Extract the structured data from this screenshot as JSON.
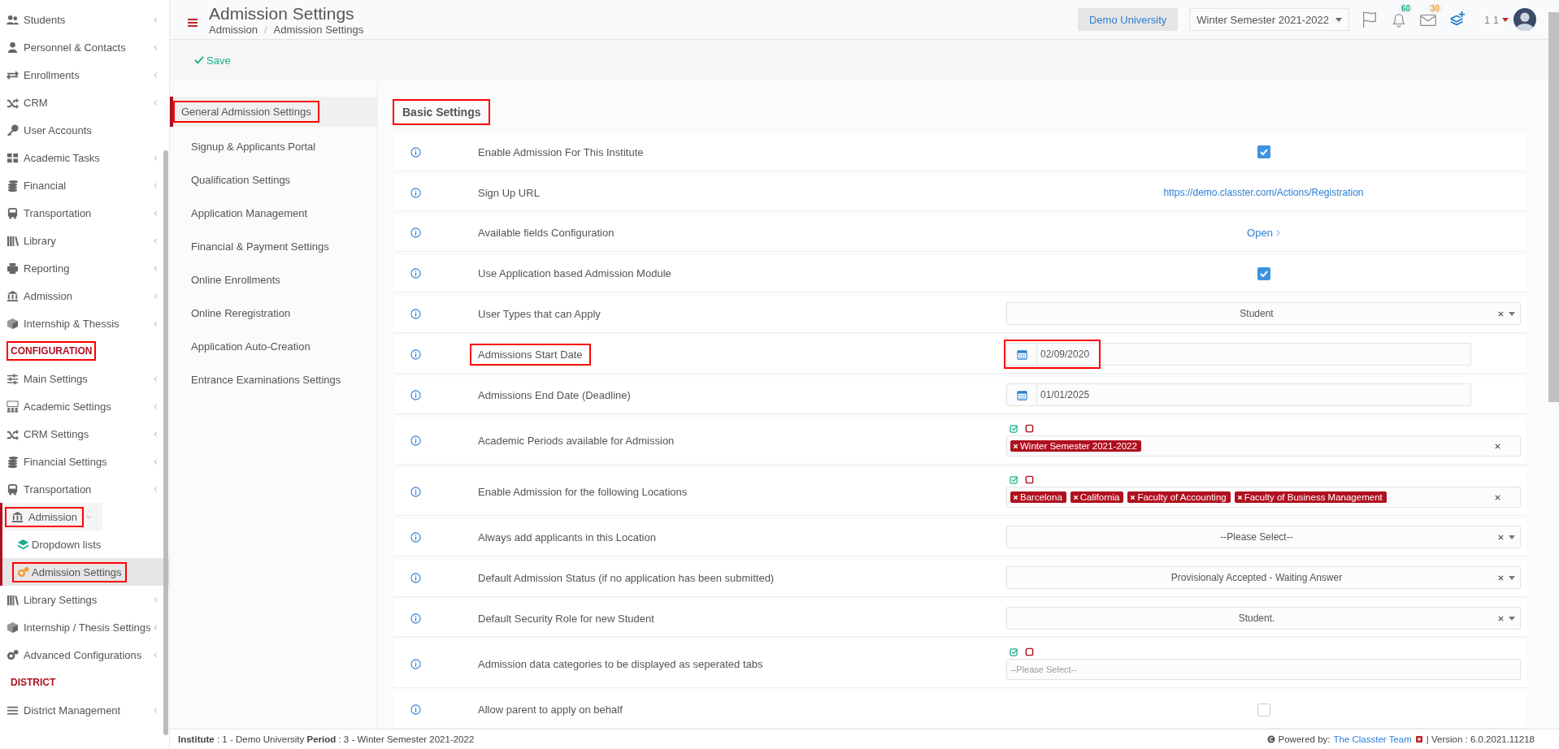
{
  "sidebar": {
    "items": [
      {
        "kind": "item",
        "label": "Students",
        "submenu": true,
        "expanded": false,
        "highlighted": false
      },
      {
        "kind": "item",
        "label": "Personnel & Contacts",
        "submenu": true,
        "expanded": false,
        "highlighted": false
      },
      {
        "kind": "item",
        "label": "Enrollments",
        "submenu": true,
        "expanded": false,
        "highlighted": false
      },
      {
        "kind": "item",
        "label": "CRM",
        "submenu": true,
        "expanded": false,
        "highlighted": false
      },
      {
        "kind": "item",
        "label": "User Accounts",
        "submenu": false,
        "expanded": false,
        "highlighted": false
      },
      {
        "kind": "item",
        "label": "Academic Tasks",
        "submenu": true,
        "expanded": false,
        "highlighted": false
      },
      {
        "kind": "item",
        "label": "Financial",
        "submenu": true,
        "expanded": false,
        "highlighted": false
      },
      {
        "kind": "item",
        "label": "Transportation",
        "submenu": true,
        "expanded": false,
        "highlighted": false
      },
      {
        "kind": "item",
        "label": "Library",
        "submenu": true,
        "expanded": false,
        "highlighted": false
      },
      {
        "kind": "item",
        "label": "Reporting",
        "submenu": true,
        "expanded": false,
        "highlighted": false
      },
      {
        "kind": "item",
        "label": "Admission",
        "submenu": true,
        "expanded": false,
        "highlighted": false
      },
      {
        "kind": "item",
        "label": "Internship & Thessis",
        "submenu": true,
        "expanded": false,
        "highlighted": false
      },
      {
        "kind": "heading",
        "label": "CONFIGURATION",
        "highlighted": true
      },
      {
        "kind": "item",
        "label": "Main Settings",
        "submenu": true,
        "expanded": false,
        "highlighted": false
      },
      {
        "kind": "item",
        "label": "Academic Settings",
        "submenu": true,
        "expanded": false,
        "highlighted": false
      },
      {
        "kind": "item",
        "label": "CRM Settings",
        "submenu": true,
        "expanded": false,
        "highlighted": false
      },
      {
        "kind": "item",
        "label": "Financial Settings",
        "submenu": true,
        "expanded": false,
        "highlighted": false
      },
      {
        "kind": "item",
        "label": "Transportation",
        "submenu": true,
        "expanded": false,
        "highlighted": false
      },
      {
        "kind": "item",
        "label": "Admission",
        "submenu": true,
        "expanded": true,
        "highlighted": true,
        "children": [
          {
            "label": "Dropdown lists",
            "selected": false,
            "highlighted": false
          },
          {
            "label": "Admission Settings",
            "selected": true,
            "highlighted": true
          }
        ]
      },
      {
        "kind": "item",
        "label": "Library Settings",
        "submenu": true,
        "expanded": false,
        "highlighted": false
      },
      {
        "kind": "item",
        "label": "Internship / Thesis Settings",
        "submenu": true,
        "expanded": false,
        "highlighted": false
      },
      {
        "kind": "item",
        "label": "Advanced Configurations",
        "submenu": true,
        "expanded": false,
        "highlighted": false
      },
      {
        "kind": "heading",
        "label": "DISTRICT",
        "highlighted": false
      },
      {
        "kind": "item",
        "label": "District Management",
        "submenu": true,
        "expanded": false,
        "highlighted": false
      }
    ]
  },
  "header": {
    "title": "Admission Settings",
    "breadcrumb": [
      "Admission",
      "Admission Settings"
    ],
    "separator": "/",
    "institution": "Demo University",
    "period": "Winter Semester 2021-2022",
    "notifications": [
      {
        "count": "60",
        "color": "#1aae8c"
      },
      {
        "count": "30",
        "color": "#f0a040"
      }
    ],
    "user": "1 1"
  },
  "toolbar": {
    "save": "Save"
  },
  "settings_menu": [
    {
      "label": "General Admission Settings",
      "selected": true,
      "highlighted": true
    },
    {
      "label": "Signup & Applicants Portal",
      "selected": false,
      "highlighted": false
    },
    {
      "label": "Qualification Settings",
      "selected": false,
      "highlighted": false
    },
    {
      "label": "Application Management",
      "selected": false,
      "highlighted": false
    },
    {
      "label": "Financial & Payment Settings",
      "selected": false,
      "highlighted": false
    },
    {
      "label": "Online Enrollments",
      "selected": false,
      "highlighted": false
    },
    {
      "label": "Online Reregistration",
      "selected": false,
      "highlighted": false
    },
    {
      "label": "Application Auto-Creation",
      "selected": false,
      "highlighted": false
    },
    {
      "label": "Entrance Examinations Settings",
      "selected": false,
      "highlighted": false
    }
  ],
  "section": {
    "title": "Basic Settings",
    "highlighted": true
  },
  "rows": [
    {
      "kind": "checkbox",
      "label": "Enable Admission For This Institute",
      "checked": true
    },
    {
      "kind": "link",
      "label": "Sign Up URL",
      "value": "https://demo.classter.com/Actions/Registration"
    },
    {
      "kind": "open",
      "label": "Available fields Configuration",
      "value": "Open"
    },
    {
      "kind": "checkbox",
      "label": "Use Application based Admission Module",
      "checked": true
    },
    {
      "kind": "select",
      "label": "User Types that can Apply",
      "value": "Student"
    },
    {
      "kind": "date",
      "label": "Admissions Start Date",
      "value": "02/09/2020",
      "label_highlighted": true,
      "value_highlighted": true
    },
    {
      "kind": "date",
      "label": "Admissions End Date (Deadline)",
      "value": "01/01/2025"
    },
    {
      "kind": "tags",
      "label": "Academic Periods available for Admission",
      "tags": [
        "Winter Semester 2021-2022"
      ]
    },
    {
      "kind": "tags",
      "label": "Enable Admission for the following Locations",
      "tags": [
        "Barcelona",
        "California",
        "Faculty of Accounting",
        "Faculty of Business Management"
      ]
    },
    {
      "kind": "select",
      "label": "Always add applicants in this Location",
      "value": "--Please Select--"
    },
    {
      "kind": "select",
      "label": "Default Admission Status (if no application has been submitted)",
      "value": "Provisionaly Accepted - Waiting Answer"
    },
    {
      "kind": "select",
      "label": "Default Security Role for new Student",
      "value": "Student."
    },
    {
      "kind": "multi",
      "label": "Admission data categories to be displayed as seperated tabs",
      "placeholder": "--Please Select--"
    },
    {
      "kind": "checkbox",
      "label": "Allow parent to apply on behalf",
      "checked": false
    }
  ],
  "footer": {
    "info": "**Institute** : 1 - Demo University **Period** : 3 - Winter Semester 2021-2022",
    "powered": "Powered by:",
    "team": "The Classter Team",
    "version": "| Version : 6.0.2021.11218"
  }
}
